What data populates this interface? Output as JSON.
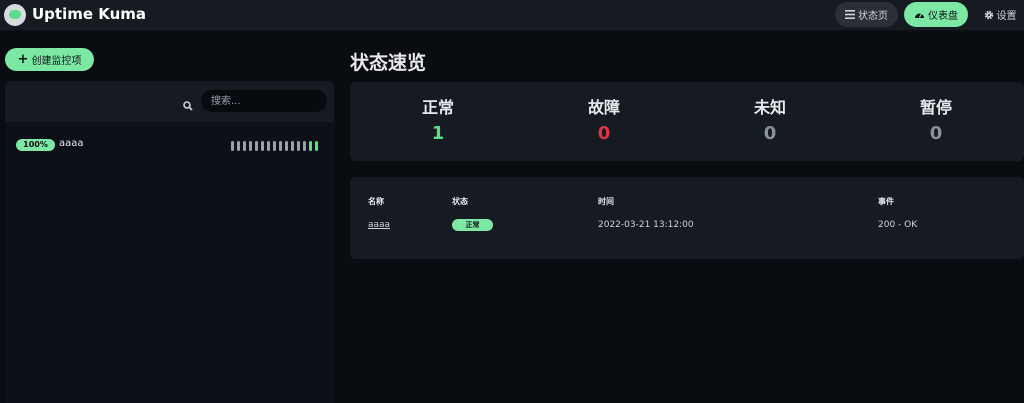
{
  "header": {
    "app_title": "Uptime Kuma",
    "nav": {
      "status_page": "状态页",
      "dashboard": "仪表盘",
      "settings": "设置"
    },
    "active_nav_color": "#7ce8a4"
  },
  "sidebar": {
    "add_button": "创建监控项",
    "search_placeholder": "搜索...",
    "monitors": [
      {
        "name": "aaaa",
        "uptime": "100%",
        "heartbeats": [
          "empty",
          "empty",
          "empty",
          "empty",
          "empty",
          "empty",
          "empty",
          "empty",
          "empty",
          "empty",
          "empty",
          "empty",
          "empty",
          "up",
          "up"
        ]
      }
    ]
  },
  "overview": {
    "title": "状态速览",
    "stats": [
      {
        "label": "正常",
        "value": "1",
        "color": "#5cdd8b"
      },
      {
        "label": "故障",
        "value": "0",
        "color": "#dc3545"
      },
      {
        "label": "未知",
        "value": "0",
        "color": "#8a9099"
      },
      {
        "label": "暂停",
        "value": "0",
        "color": "#8a9099"
      }
    ]
  },
  "events": {
    "headers": {
      "name": "名称",
      "status": "状态",
      "time": "时间",
      "message": "事件"
    },
    "rows": [
      {
        "name": "aaaa",
        "status": "正常",
        "time": "2022-03-21 13:12:00",
        "message": "200 - OK"
      }
    ]
  },
  "colors": {
    "up": "#5cdd8b",
    "down": "#dc3545",
    "empty": "#9aa0a6"
  }
}
